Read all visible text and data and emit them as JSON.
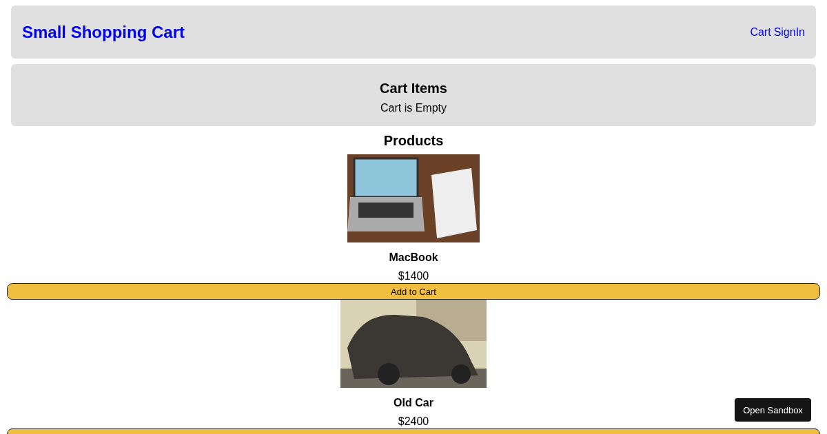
{
  "header": {
    "title": "Small Shopping Cart",
    "links": [
      "Cart",
      "SignIn"
    ]
  },
  "cart": {
    "title": "Cart Items",
    "message": "Cart is Empty"
  },
  "products": {
    "title": "Products",
    "items": [
      {
        "kind": "laptop",
        "name": "MacBook",
        "price": "$1400",
        "button": "Add to Cart"
      },
      {
        "kind": "car",
        "name": "Old Car",
        "price": "$2400"
      }
    ]
  },
  "sandbox_button": "Open Sandbox"
}
